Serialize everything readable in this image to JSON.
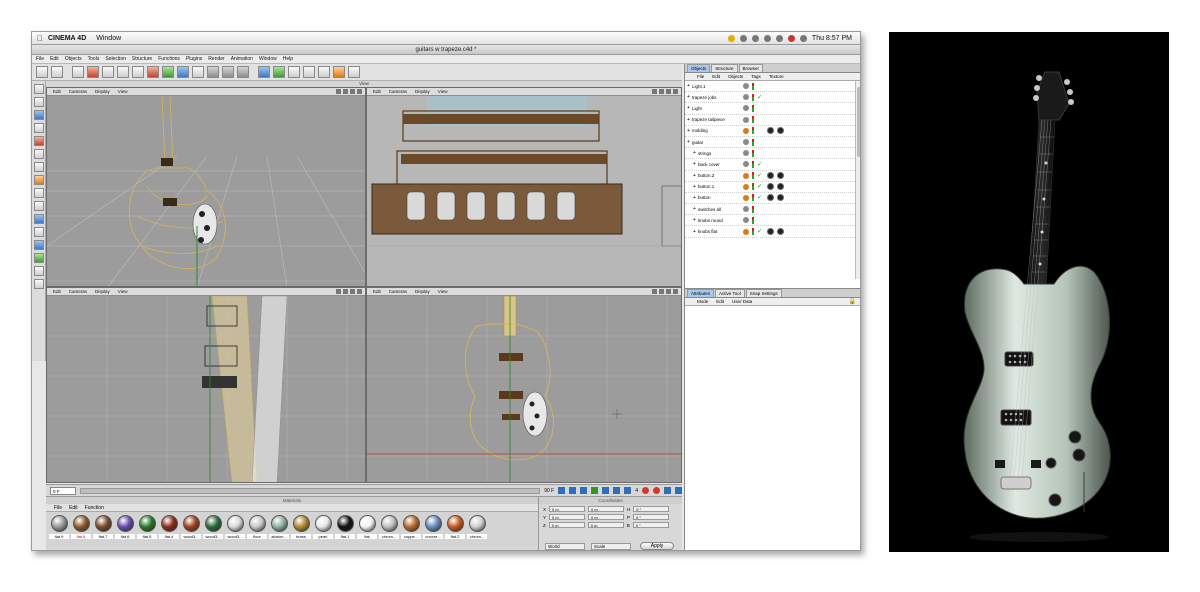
{
  "os_menubar": {
    "app_name": "CINEMA 4D",
    "items": [
      "Window"
    ],
    "clock": "Thu 8:57 PM"
  },
  "window": {
    "title": "guitars w trapeze.c4d *"
  },
  "c4d_menu": [
    "File",
    "Edit",
    "Objects",
    "Tools",
    "Selection",
    "Structure",
    "Functions",
    "Plugins",
    "Render",
    "Animation",
    "Window",
    "Help"
  ],
  "viewport_title": "View",
  "viewport_menu": [
    "Edit",
    "Cameras",
    "Display",
    "View"
  ],
  "timeline": {
    "start": "0 F",
    "end": "90 F",
    "current": "4"
  },
  "materials_panel": {
    "title": "Materials",
    "menu": [
      "File",
      "Edit",
      "Function"
    ],
    "items": [
      {
        "label": "flat.9",
        "color": "#9a9a9a",
        "selected": false
      },
      {
        "label": "flat.6",
        "color": "#8c5a2a",
        "selected": true
      },
      {
        "label": "flat.7",
        "color": "#7a4a2a",
        "selected": false
      },
      {
        "label": "flat.6",
        "color": "#6a4bb0",
        "selected": false
      },
      {
        "label": "flat.5",
        "color": "#2a7a2a",
        "selected": false
      },
      {
        "label": "flat.4",
        "color": "#8a2a1a",
        "selected": false
      },
      {
        "label": "wood3...",
        "color": "#a04020",
        "selected": false
      },
      {
        "label": "wood3...",
        "color": "#2a6a3a",
        "selected": false
      },
      {
        "label": "wood3...",
        "color": "#dadada",
        "selected": false
      },
      {
        "label": "floor",
        "color": "#c8c8c8",
        "selected": false
      },
      {
        "label": "abalon...",
        "color": "#8fb0a0",
        "selected": false
      },
      {
        "label": "brass",
        "color": "#b08a30",
        "selected": false
      },
      {
        "label": "pearl",
        "color": "#e8e8e8",
        "selected": false
      },
      {
        "label": "flat.1",
        "color": "#111111",
        "selected": false
      },
      {
        "label": "flat",
        "color": "#f2f2f2",
        "selected": false
      },
      {
        "label": "chrom...",
        "color": "#c0c0c0",
        "selected": false
      },
      {
        "label": "coppe...",
        "color": "#b86a30",
        "selected": false
      },
      {
        "label": "coocre...",
        "color": "#6a8ac0",
        "selected": false
      },
      {
        "label": "flat.2",
        "color": "#c85a20",
        "selected": false
      },
      {
        "label": "chrom...",
        "color": "#d0d0d0",
        "selected": false
      }
    ]
  },
  "coordinates_panel": {
    "title": "Coordinates",
    "rows": [
      {
        "axis": "X",
        "pos": "0 m",
        "size": "0 m",
        "rot_axis": "H",
        "rot": "0 °"
      },
      {
        "axis": "Y",
        "pos": "0 m",
        "size": "0 m",
        "rot_axis": "P",
        "rot": "0 °"
      },
      {
        "axis": "Z",
        "pos": "0 m",
        "size": "0 m",
        "rot_axis": "B",
        "rot": "0 °"
      }
    ],
    "mode": "World",
    "scale": "Scale",
    "apply": "Apply"
  },
  "object_manager": {
    "tabs": [
      "Objects",
      "Structure",
      "Browser"
    ],
    "menu": [
      "File",
      "Edit",
      "Objects",
      "Tags",
      "Texture"
    ],
    "objects": [
      {
        "name": "Light.1",
        "indent": 0,
        "orange": false,
        "check": false,
        "tags": 0
      },
      {
        "name": "trapeze jobs",
        "indent": 0,
        "orange": false,
        "check": true,
        "tags": 0
      },
      {
        "name": "Light",
        "indent": 0,
        "orange": false,
        "check": false,
        "tags": 0
      },
      {
        "name": "trapeze tailpiece",
        "indent": 0,
        "orange": false,
        "check": false,
        "tags": 0
      },
      {
        "name": "molding",
        "indent": 0,
        "orange": true,
        "check": false,
        "tags": 2
      },
      {
        "name": "guitar",
        "indent": 0,
        "orange": false,
        "check": false,
        "tags": 0
      },
      {
        "name": "strings",
        "indent": 1,
        "orange": false,
        "check": false,
        "tags": 0
      },
      {
        "name": "back cover",
        "indent": 1,
        "orange": false,
        "check": true,
        "tags": 0
      },
      {
        "name": "button.2",
        "indent": 1,
        "orange": true,
        "check": true,
        "tags": 2
      },
      {
        "name": "button.1",
        "indent": 1,
        "orange": true,
        "check": true,
        "tags": 2
      },
      {
        "name": "button",
        "indent": 1,
        "orange": true,
        "check": true,
        "tags": 2
      },
      {
        "name": "switches all",
        "indent": 1,
        "orange": false,
        "check": false,
        "tags": 0
      },
      {
        "name": "knobs round",
        "indent": 1,
        "orange": false,
        "check": false,
        "tags": 0
      },
      {
        "name": "knobs flat",
        "indent": 1,
        "orange": true,
        "check": true,
        "tags": 2
      }
    ]
  },
  "attribute_manager": {
    "tabs": [
      "Attributes",
      "Active Tool",
      "Snap Settings"
    ],
    "menu": [
      "Mode",
      "Edit",
      "User Data"
    ]
  }
}
